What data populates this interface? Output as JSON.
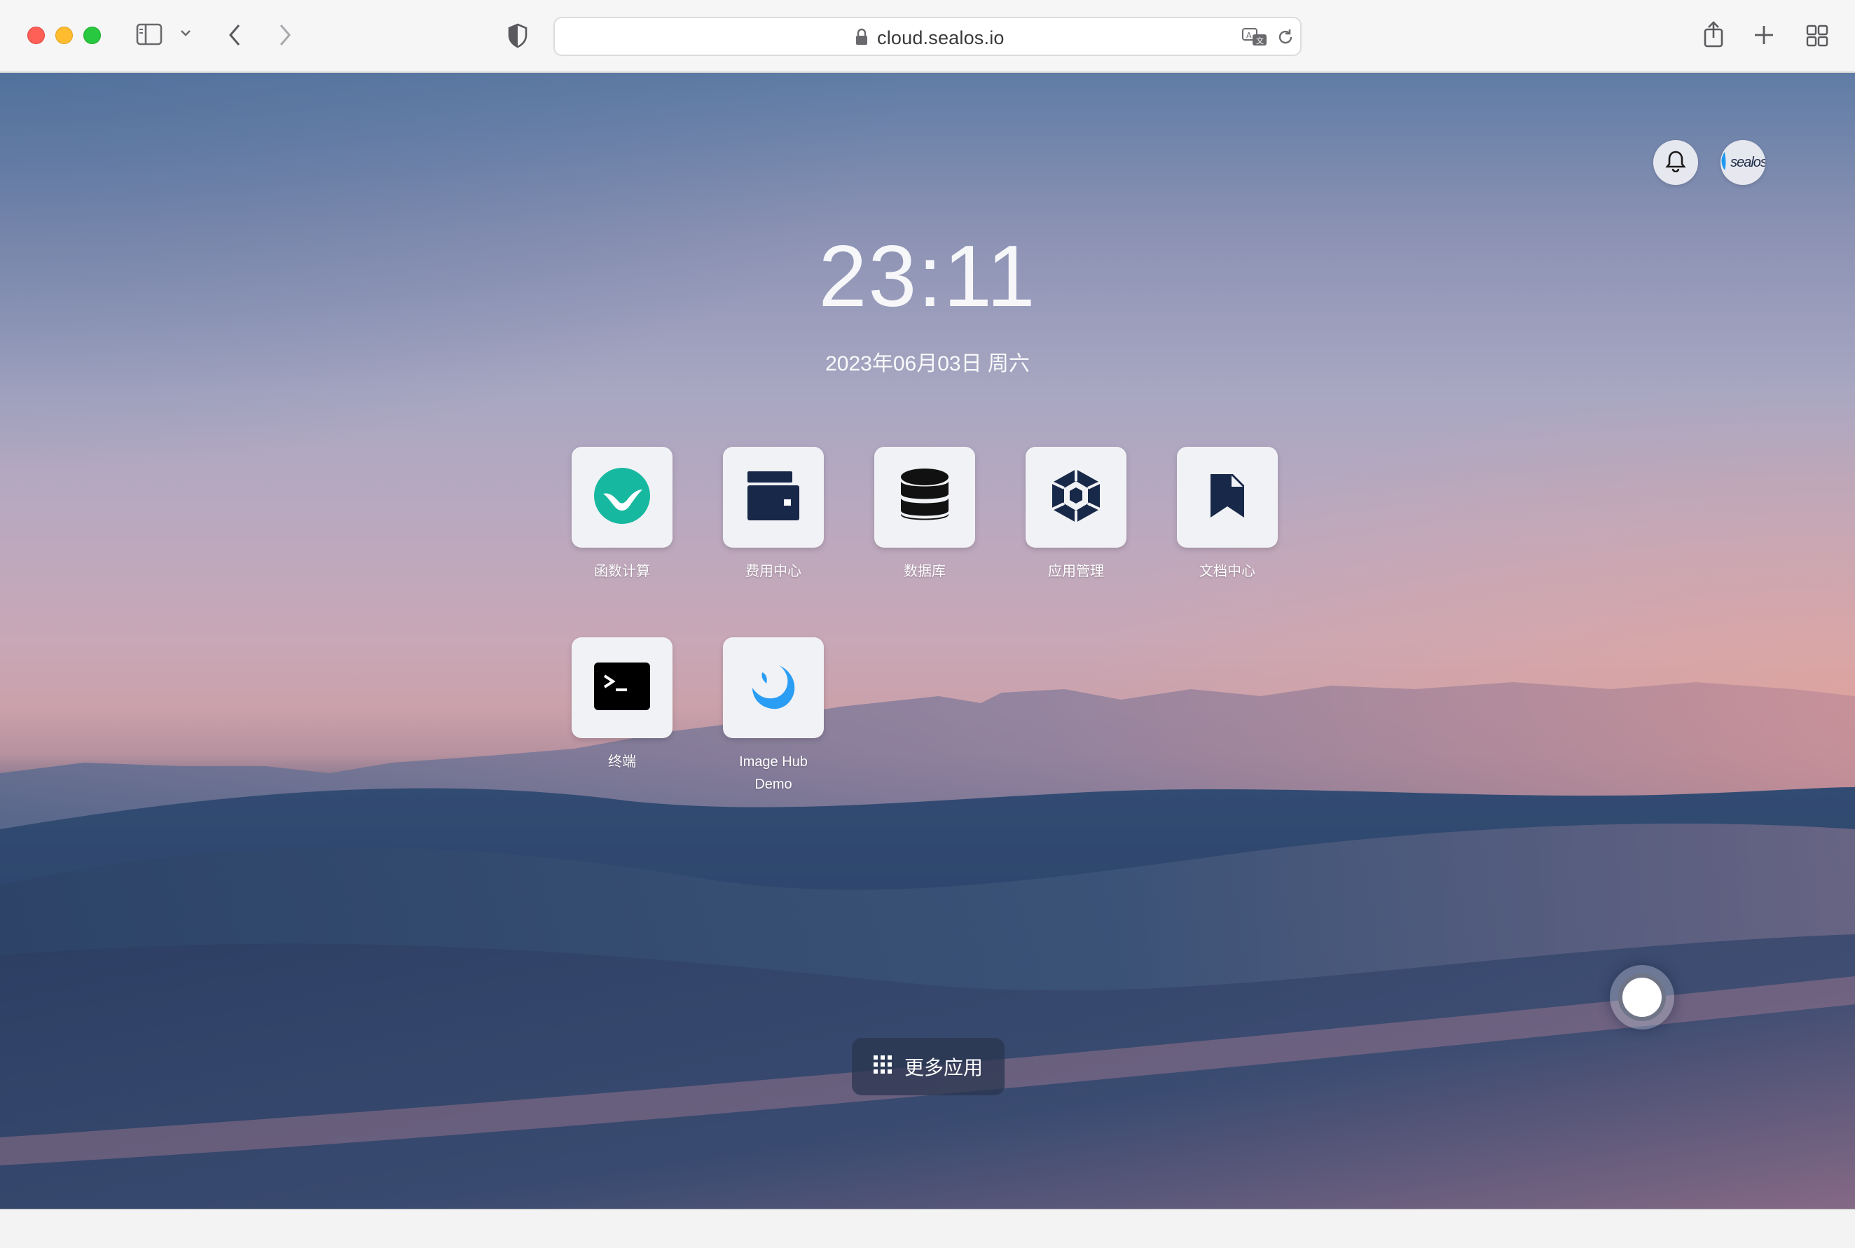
{
  "browser": {
    "url": "cloud.sealos.io"
  },
  "desktop": {
    "time": "23:11",
    "date": "2023年06月03日 周六",
    "avatar_text": "sealos",
    "apps": [
      {
        "label": "函数计算",
        "icon": "laf-function-icon"
      },
      {
        "label": "费用中心",
        "icon": "wallet-icon"
      },
      {
        "label": "数据库",
        "icon": "database-icon"
      },
      {
        "label": "应用管理",
        "icon": "app-launchpad-icon"
      },
      {
        "label": "文档中心",
        "icon": "docs-icon"
      },
      {
        "label": "终端",
        "icon": "terminal-icon"
      },
      {
        "label": "Image Hub Demo",
        "icon": "image-hub-icon"
      }
    ],
    "more_apps_label": "更多应用"
  },
  "colors": {
    "laf_green": "#16b8a0",
    "dark_navy": "#182848",
    "terminal_black": "#000000",
    "image_hub_blue": "#2a9df4"
  }
}
